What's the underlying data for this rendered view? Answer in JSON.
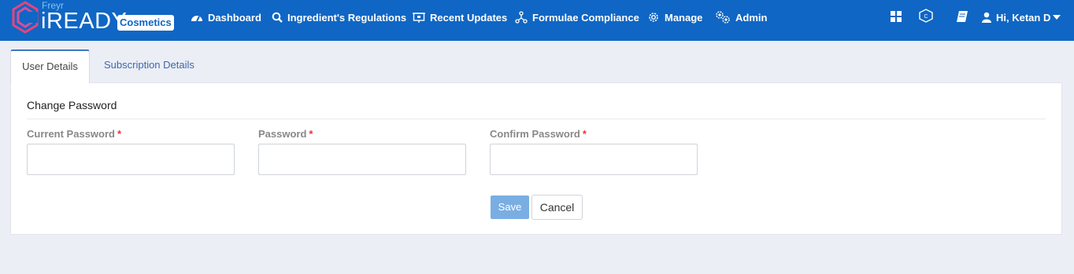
{
  "brand": {
    "maker": "Freyr",
    "product": "iREADY",
    "module": "Cosmetics"
  },
  "nav": [
    {
      "label": "Dashboard",
      "icon": "dashboard-icon"
    },
    {
      "label": "Ingredient's Regulations",
      "icon": "search-icon"
    },
    {
      "label": "Recent Updates",
      "icon": "presentation-icon"
    },
    {
      "label": "Formulae Compliance",
      "icon": "molecule-icon"
    },
    {
      "label": "Manage",
      "icon": "gear-icon"
    },
    {
      "label": "Admin",
      "icon": "gears-icon"
    }
  ],
  "right_nav": {
    "apps_icon": "grid-icon",
    "cosmetics_icon": "cosmetics-icon",
    "docs_icon": "book-icon",
    "user_greeting": "Hi, Ketan D"
  },
  "tabs": [
    {
      "label": "User Details",
      "active": true
    },
    {
      "label": "Subscription Details",
      "active": false
    }
  ],
  "form": {
    "title": "Change Password",
    "fields": [
      {
        "label": "Current Password",
        "required": "*",
        "value": ""
      },
      {
        "label": "Password",
        "required": "*",
        "value": ""
      },
      {
        "label": "Confirm Password",
        "required": "*",
        "value": ""
      }
    ],
    "save_label": "Save",
    "cancel_label": "Cancel"
  },
  "colors": {
    "header": "#0f66c4",
    "save_button": "#7aaee2",
    "required": "#e33333",
    "page_bg": "#eceef6"
  }
}
